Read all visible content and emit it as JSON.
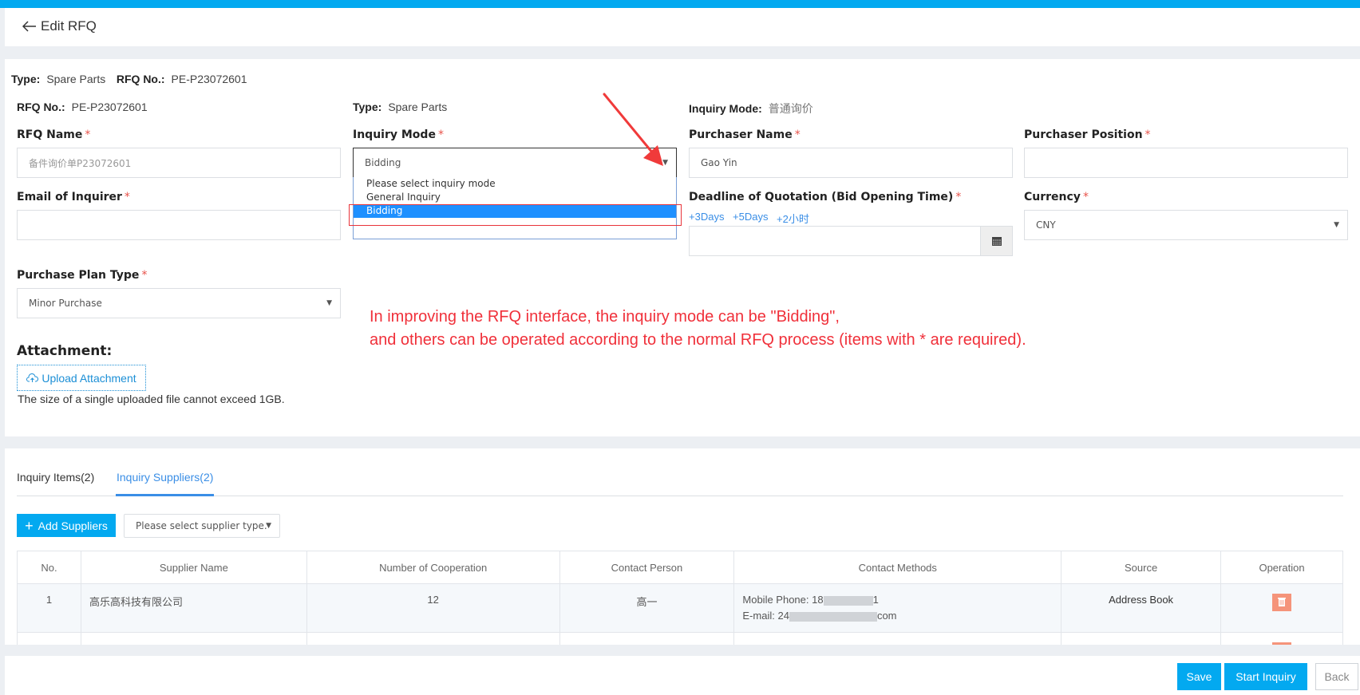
{
  "header": {
    "title": "Edit RFQ"
  },
  "summary": {
    "type_label": "Type:",
    "type_value": "Spare Parts",
    "rfq_no_label": "RFQ No.:",
    "rfq_no_value": "PE-P23072601"
  },
  "info_row": {
    "rfq_no_label": "RFQ No.:",
    "rfq_no_value": "PE-P23072601",
    "type_label": "Type:",
    "type_value": "Spare Parts",
    "inquiry_mode_label": "Inquiry Mode:",
    "inquiry_mode_value": "普通询价"
  },
  "form": {
    "rfq_name": {
      "label": "RFQ Name",
      "placeholder": "备件询价单P23072601",
      "value": ""
    },
    "inquiry_mode": {
      "label": "Inquiry Mode",
      "value": "Bidding",
      "options": [
        "Please select inquiry mode",
        "General Inquiry",
        "Bidding"
      ],
      "selected_index": 2
    },
    "purchaser_name": {
      "label": "Purchaser Name",
      "value": "Gao Yin"
    },
    "purchaser_position": {
      "label": "Purchaser Position",
      "value": ""
    },
    "email": {
      "label": "Email of Inquirer",
      "value": ""
    },
    "deadline": {
      "label": "Deadline of Quotation (Bid Opening Time)",
      "quick_options": [
        "+3Days",
        "+5Days",
        "+2小时"
      ],
      "value": ""
    },
    "currency": {
      "label": "Currency",
      "value": "CNY"
    },
    "purchase_plan_type": {
      "label": "Purchase Plan Type",
      "value": "Minor Purchase"
    },
    "required_mark": "*"
  },
  "attachment": {
    "label": "Attachment:",
    "upload_label": "Upload Attachment",
    "hint": "The size of a single uploaded file cannot exceed 1GB."
  },
  "annotation": {
    "line1": "In improving the RFQ interface, the inquiry mode can be \"Bidding\",",
    "line2": "and others can be operated according to the normal RFQ process (items with * are required).",
    "color": "#f0303a"
  },
  "tabs": [
    {
      "label": "Inquiry Items(2)",
      "active": false
    },
    {
      "label": "Inquiry Suppliers(2)",
      "active": true
    }
  ],
  "suppliers": {
    "add_button": "Add Suppliers",
    "type_select_placeholder": "Please select supplier type.",
    "columns": [
      "No.",
      "Supplier Name",
      "Number of Cooperation",
      "Contact Person",
      "Contact Methods",
      "Source",
      "Operation"
    ],
    "rows": [
      {
        "no": "1",
        "name": "高乐高科技有限公司",
        "cooperation": "12",
        "contact": "高一",
        "phone_label": "Mobile Phone:",
        "phone_prefix": "18",
        "phone_suffix": "1",
        "email_label": "E-mail:",
        "email_prefix": "24",
        "email_suffix": "com",
        "source": "Address Book"
      }
    ]
  },
  "footer": {
    "save": "Save",
    "start_inquiry": "Start Inquiry",
    "back": "Back"
  },
  "colors": {
    "primary": "#03a9f0",
    "link": "#3a8ee6",
    "required": "#e8524a",
    "delete": "#f5947a"
  }
}
